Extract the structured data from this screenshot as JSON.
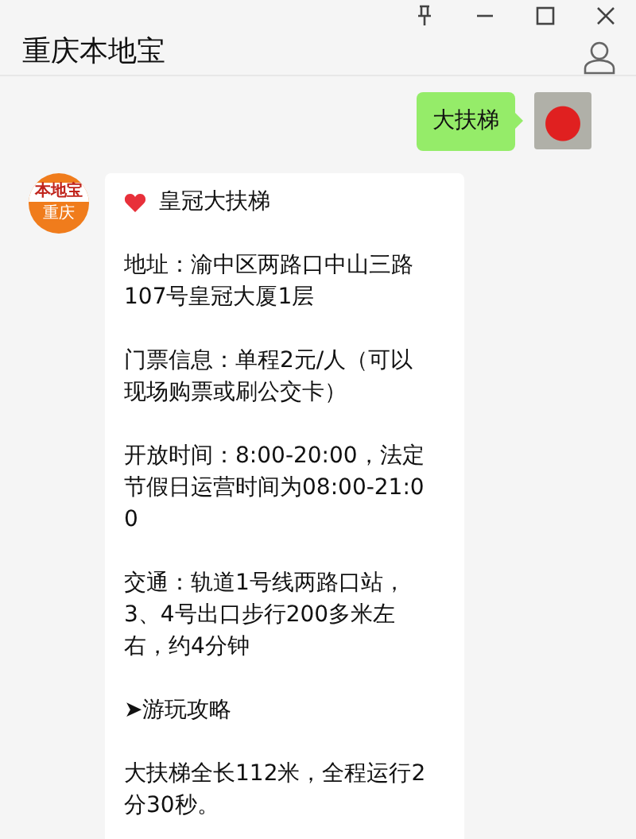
{
  "window": {
    "title": "重庆本地宝"
  },
  "messages": [
    {
      "kind": "sent",
      "text": "大扶梯"
    },
    {
      "kind": "received",
      "avatar": {
        "brand": "本地宝",
        "city": "重庆"
      },
      "title": "皇冠大扶梯",
      "paragraphs": [
        "地址：渝中区两路口中山三路107号皇冠大厦1层",
        "门票信息：单程2元/人（可以现场购票或刷公交卡）",
        "开放时间：8:00-20:00，法定节假日运营时间为08:00-21:00",
        "交通：轨道1号线两路口站，3、4号出口步行200多米左右，约4分钟",
        "➤游玩攻略",
        "大扶梯全长112米，全程运行2分30秒。"
      ]
    }
  ]
}
